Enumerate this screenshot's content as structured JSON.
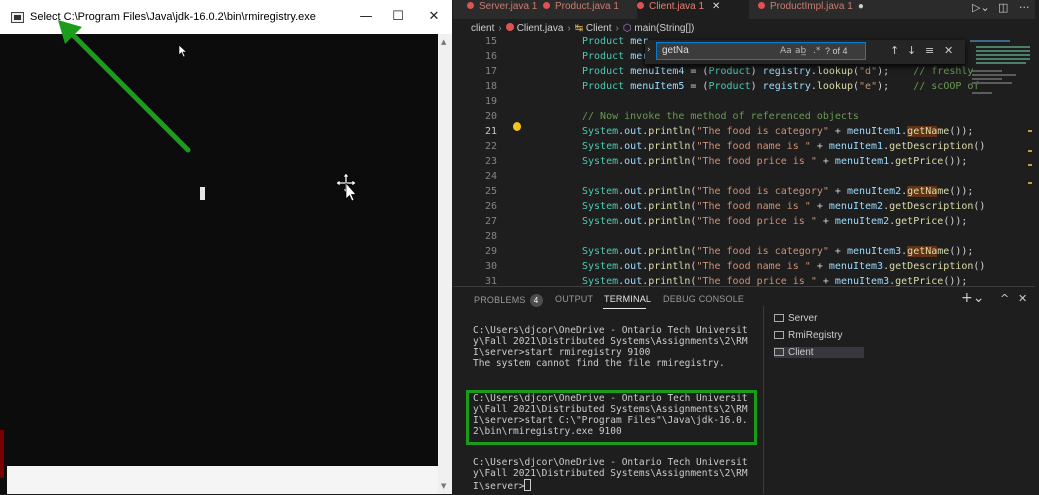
{
  "console_window": {
    "title": "Select C:\\Program Files\\Java\\jdk-16.0.2\\bin\\rmiregistry.exe",
    "minimize": "—",
    "maximize": "☐",
    "close": "✕"
  },
  "editor": {
    "tabs": [
      {
        "label": "Server.java 1"
      },
      {
        "label": "Product.java 1"
      },
      {
        "label": "Client.java 1"
      },
      {
        "label": "ProductImpl.java 1"
      }
    ],
    "breadcrumb": {
      "folder": "client",
      "file": "Client.java",
      "class": "Client",
      "method": "main(String[])"
    },
    "find": {
      "query": "getNa",
      "count": "? of 4",
      "match_case": "Aa",
      "whole_word": "ab̲",
      "regex": ".*"
    },
    "line_numbers": [
      "15",
      "16",
      "17",
      "18",
      "19",
      "20",
      "21",
      "22",
      "23",
      "24",
      "25",
      "26",
      "27",
      "28",
      "29",
      "30",
      "31"
    ],
    "active_line": "21"
  },
  "panel": {
    "tabs": {
      "problems": "PROBLEMS",
      "problems_count": "4",
      "output": "OUTPUT",
      "terminal": "TERMINAL",
      "debug": "DEBUG CONSOLE"
    },
    "terminal_lines": [
      "C:\\Users\\djcor\\OneDrive - Ontario Tech Universit",
      "y\\Fall 2021\\Distributed Systems\\Assignments\\2\\RM",
      "I\\server>start rmiregistry 9100",
      "The system cannot find the file rmiregistry.",
      "",
      "C:\\Users\\djcor\\OneDrive - Ontario Tech Universit",
      "y\\Fall 2021\\Distributed Systems\\Assignments\\2\\RM",
      "I\\server>start C:\\\"Program Files\"\\Java\\jdk-16.0.",
      "2\\bin\\rmiregistry.exe 9100",
      "",
      "C:\\Users\\djcor\\OneDrive - Ontario Tech Universit",
      "y\\Fall 2021\\Distributed Systems\\Assignments\\2\\RM",
      "I\\server>"
    ],
    "terminals": [
      "Server",
      "RmiRegistry",
      "Client"
    ]
  }
}
